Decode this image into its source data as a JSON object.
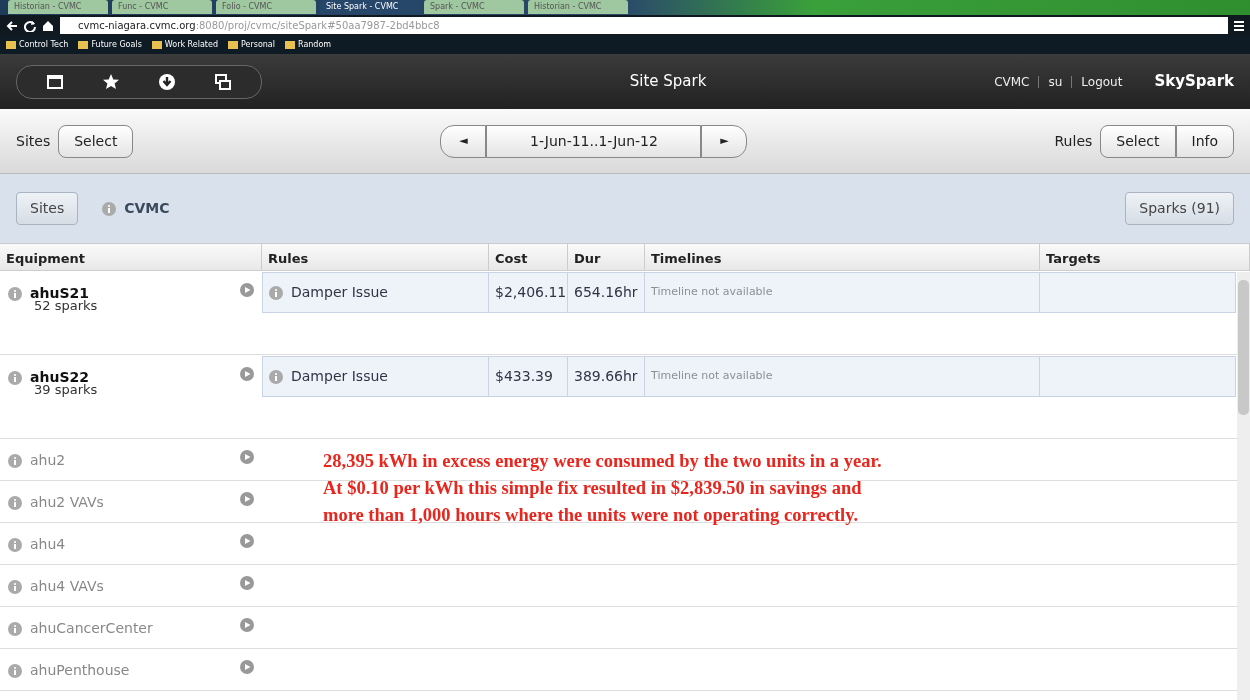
{
  "browser": {
    "tabs": [
      {
        "label": "Historian - CVMC",
        "selected": false
      },
      {
        "label": "Func - CVMC",
        "selected": false
      },
      {
        "label": "Folio - CVMC",
        "selected": false
      },
      {
        "label": "Site Spark - CVMC",
        "selected": true
      },
      {
        "label": "Spark - CVMC",
        "selected": false
      },
      {
        "label": "Historian - CVMC",
        "selected": false
      }
    ],
    "url_host": "cvmc-niagara.cvmc.org",
    "url_rest": ":8080/proj/cvmc/siteSpark#50aa7987-2bd4bbc8",
    "bookmarks": [
      "Control Tech",
      "Future Goals",
      "Work Related",
      "Personal",
      "Random"
    ]
  },
  "header": {
    "title": "Site Spark",
    "links": [
      "CVMC",
      "su",
      "Logout"
    ],
    "brand": "SkySpark"
  },
  "toolbar": {
    "sites_label": "Sites",
    "sites_button": "Select",
    "prev": "◄",
    "range": "1-Jun-11..1-Jun-12",
    "next": "►",
    "rules_label": "Rules",
    "rules_buttons": [
      "Select",
      "Info"
    ]
  },
  "site_bar": {
    "sites_button": "Sites",
    "site": "CVMC",
    "sparks_button": "Sparks (91)"
  },
  "table": {
    "columns": [
      "Equipment",
      "Rules",
      "Cost",
      "Dur",
      "Timelines",
      "Targets"
    ],
    "rows": [
      {
        "name": "ahuS21",
        "sparks": "52 sparks",
        "active": true,
        "rules": [
          {
            "rule": "Damper Issue",
            "cost": "$2,406.11",
            "dur": "654.16hr",
            "timeline": "Timeline not available"
          }
        ]
      },
      {
        "name": "ahuS22",
        "sparks": "39 sparks",
        "active": true,
        "rules": [
          {
            "rule": "Damper Issue",
            "cost": "$433.39",
            "dur": "389.66hr",
            "timeline": "Timeline not available"
          }
        ]
      },
      {
        "name": "ahu2",
        "active": false
      },
      {
        "name": "ahu2 VAVs",
        "active": false
      },
      {
        "name": "ahu4",
        "active": false
      },
      {
        "name": "ahu4 VAVs",
        "active": false
      },
      {
        "name": "ahuCancerCenter",
        "active": false
      },
      {
        "name": "ahuPenthouse",
        "active": false
      }
    ]
  },
  "annotation": {
    "lines": [
      "28,395 kWh in excess energy were consumed by the two units in a year.",
      "At $0.10 per kWh this simple fix resulted in $2,839.50 in savings and",
      "more than 1,000 hours where the units were not operating correctly."
    ]
  }
}
